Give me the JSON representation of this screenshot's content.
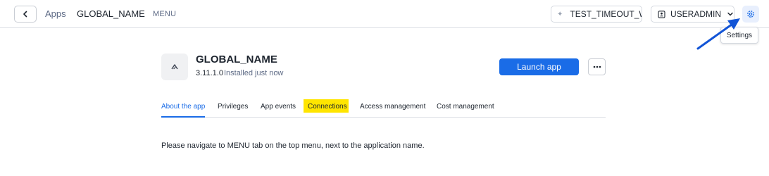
{
  "header": {
    "breadcrumb_apps": "Apps",
    "breadcrumb_app": "GLOBAL_NAME",
    "menu_tab": "MENU",
    "warehouse": "TEST_TIMEOUT_WH",
    "role": "USERADMIN",
    "settings_tooltip": "Settings"
  },
  "app": {
    "title": "GLOBAL_NAME",
    "version": "3.11.1.0",
    "installed": "Installed just now",
    "launch_label": "Launch app"
  },
  "tabs": [
    {
      "label": "About the app",
      "active": true
    },
    {
      "label": "Privileges"
    },
    {
      "label": "App events"
    },
    {
      "label": "Connections",
      "highlighted": true
    },
    {
      "label": "Access management"
    },
    {
      "label": "Cost management"
    }
  ],
  "body_text": "Please navigate to MENU tab on the top menu, next to the application name.",
  "colors": {
    "accent": "#1a6ce7",
    "highlight": "#ffe500",
    "annotation_arrow": "#1254d6"
  },
  "icons": {
    "back": "chevron-left-icon",
    "warehouse": "dot-icon",
    "role": "user-badge-icon",
    "role_dropdown": "chevron-down-icon",
    "settings": "gear-icon",
    "app": "app-logo-icon",
    "more": "ellipsis-icon",
    "annotation": "arrow-icon"
  }
}
